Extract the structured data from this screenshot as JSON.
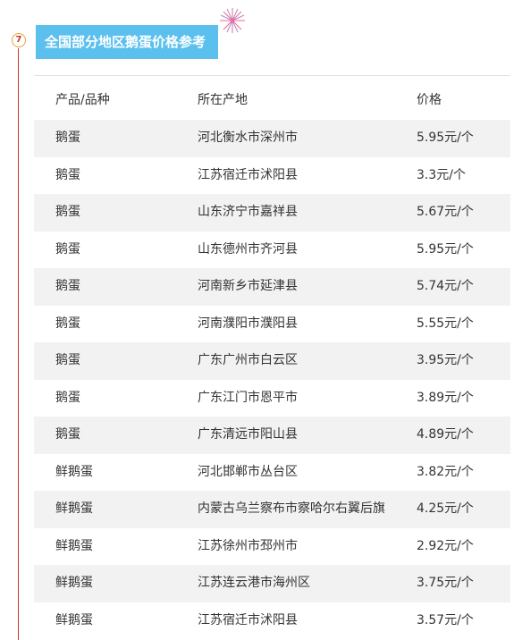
{
  "section": {
    "number": "7",
    "title": "全国部分地区鹅蛋价格参考"
  },
  "table": {
    "headers": [
      "产品/品种",
      "所在产地",
      "价格"
    ],
    "rows": [
      {
        "product": "鹅蛋",
        "origin": "河北衡水市深州市",
        "price": "5.95元/个"
      },
      {
        "product": "鹅蛋",
        "origin": "江苏宿迁市沭阳县",
        "price": "3.3元/个"
      },
      {
        "product": "鹅蛋",
        "origin": "山东济宁市嘉祥县",
        "price": "5.67元/个"
      },
      {
        "product": "鹅蛋",
        "origin": "山东德州市齐河县",
        "price": "5.95元/个"
      },
      {
        "product": "鹅蛋",
        "origin": "河南新乡市延津县",
        "price": "5.74元/个"
      },
      {
        "product": "鹅蛋",
        "origin": "河南濮阳市濮阳县",
        "price": "5.55元/个"
      },
      {
        "product": "鹅蛋",
        "origin": "广东广州市白云区",
        "price": "3.95元/个"
      },
      {
        "product": "鹅蛋",
        "origin": "广东江门市恩平市",
        "price": "3.89元/个"
      },
      {
        "product": "鹅蛋",
        "origin": "广东清远市阳山县",
        "price": "4.89元/个"
      },
      {
        "product": "鲜鹅蛋",
        "origin": "河北邯郸市丛台区",
        "price": "3.82元/个"
      },
      {
        "product": "鲜鹅蛋",
        "origin": "内蒙古乌兰察布市察哈尔右翼后旗",
        "price": "4.25元/个"
      },
      {
        "product": "鲜鹅蛋",
        "origin": "江苏徐州市邳州市",
        "price": "2.92元/个"
      },
      {
        "product": "鲜鹅蛋",
        "origin": "江苏连云港市海州区",
        "price": "3.75元/个"
      },
      {
        "product": "鲜鹅蛋",
        "origin": "江苏宿迁市沭阳县",
        "price": "3.57元/个"
      }
    ]
  },
  "colors": {
    "title_bg": "#5bc0ee",
    "accent_line": "#c0392b",
    "alt_row": "#f2f2f2"
  }
}
